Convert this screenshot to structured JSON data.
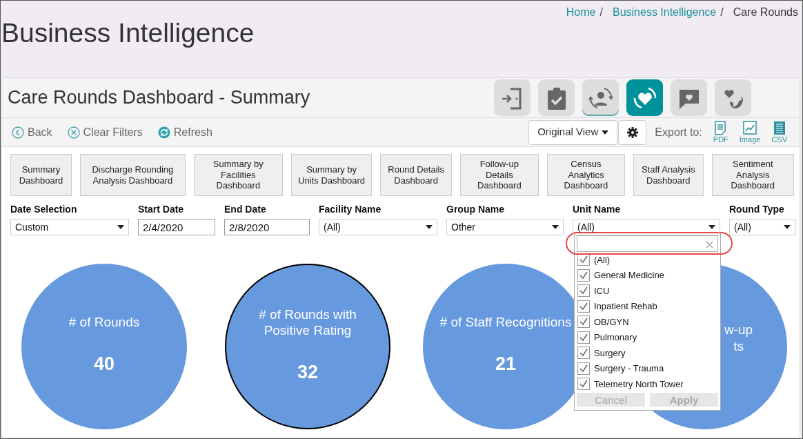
{
  "breadcrumb": [
    {
      "label": "Home",
      "link": true,
      "separator": "/"
    },
    {
      "label": "Business Intelligence",
      "link": true,
      "separator": "/"
    },
    {
      "label": "Care Rounds",
      "link": false
    }
  ],
  "page_title": "Business Intelligence",
  "dashboard": {
    "title": "Care Rounds Dashboard - Summary",
    "icon_tiles": [
      {
        "kind": "door",
        "selected": false,
        "underlined": false
      },
      {
        "kind": "clipboard",
        "selected": false,
        "underlined": false
      },
      {
        "kind": "person-cycle",
        "selected": false,
        "underlined": true
      },
      {
        "kind": "heart-cycle",
        "selected": true,
        "underlined": false
      },
      {
        "kind": "speech-heart",
        "selected": false,
        "underlined": false
      },
      {
        "kind": "phone-heart",
        "selected": false,
        "underlined": false
      }
    ],
    "toolbar": [
      {
        "kind": "back",
        "label": "Back"
      },
      {
        "kind": "clear",
        "label": "Clear Filters"
      },
      {
        "kind": "refresh",
        "label": "Refresh"
      }
    ],
    "view_select": "Original View",
    "export_label": "Export to:",
    "exports": [
      {
        "kind": "pdf",
        "label": "PDF"
      },
      {
        "kind": "image",
        "label": "Image"
      },
      {
        "kind": "csv",
        "label": "CSV"
      }
    ],
    "dashboard_buttons": [
      "Summary Dashboard",
      "Discharge Rounding Analysis Dashboard",
      "Summary by Facilities Dashboard",
      "Summary by Units Dashboard",
      "Round Details Dashboard",
      "Follow-up Details Dashboard",
      "Census Analytics Dashboard",
      "Staff Analysis Dashboard",
      "Sentiment Analysis Dashboard"
    ],
    "filters": [
      {
        "label": "Date Selection",
        "kind": "select",
        "value": "Custom"
      },
      {
        "label": "Start Date",
        "kind": "date",
        "value": "2/4/2020"
      },
      {
        "label": "End Date",
        "kind": "date",
        "value": "2/8/2020"
      },
      {
        "label": "Facility Name",
        "kind": "select",
        "value": "(All)"
      },
      {
        "label": "Group Name",
        "kind": "select",
        "value": "Other"
      },
      {
        "label": "Unit Name",
        "kind": "select",
        "value": "(All)"
      },
      {
        "label": "Round Type",
        "kind": "select",
        "value": "(All)"
      }
    ],
    "metrics": [
      {
        "lines": [
          "# of Rounds"
        ],
        "value": "40",
        "outlined": false
      },
      {
        "lines": [
          "# of Rounds with",
          "Positive Rating"
        ],
        "value": "32",
        "outlined": true
      },
      {
        "lines": [
          "# of Staff Recognitions"
        ],
        "value": "21",
        "outlined": false
      },
      {
        "lines": [
          "w-up",
          "ts"
        ],
        "outlined": false
      }
    ],
    "unit_dropdown": {
      "highlighted": true,
      "options": [
        {
          "label": "(All)",
          "checked": true
        },
        {
          "label": "General Medicine",
          "checked": true
        },
        {
          "label": "ICU",
          "checked": true
        },
        {
          "label": "Inpatient Rehab",
          "checked": true
        },
        {
          "label": "OB/GYN",
          "checked": true
        },
        {
          "label": "Pulmonary",
          "checked": true
        },
        {
          "label": "Surgery",
          "checked": true
        },
        {
          "label": "Surgery - Trauma",
          "checked": true
        },
        {
          "label": "Telemetry North Tower",
          "checked": true
        }
      ],
      "buttons": [
        {
          "label": "Cancel",
          "disabled": true
        },
        {
          "label": "Apply",
          "disabled": true
        }
      ]
    }
  }
}
